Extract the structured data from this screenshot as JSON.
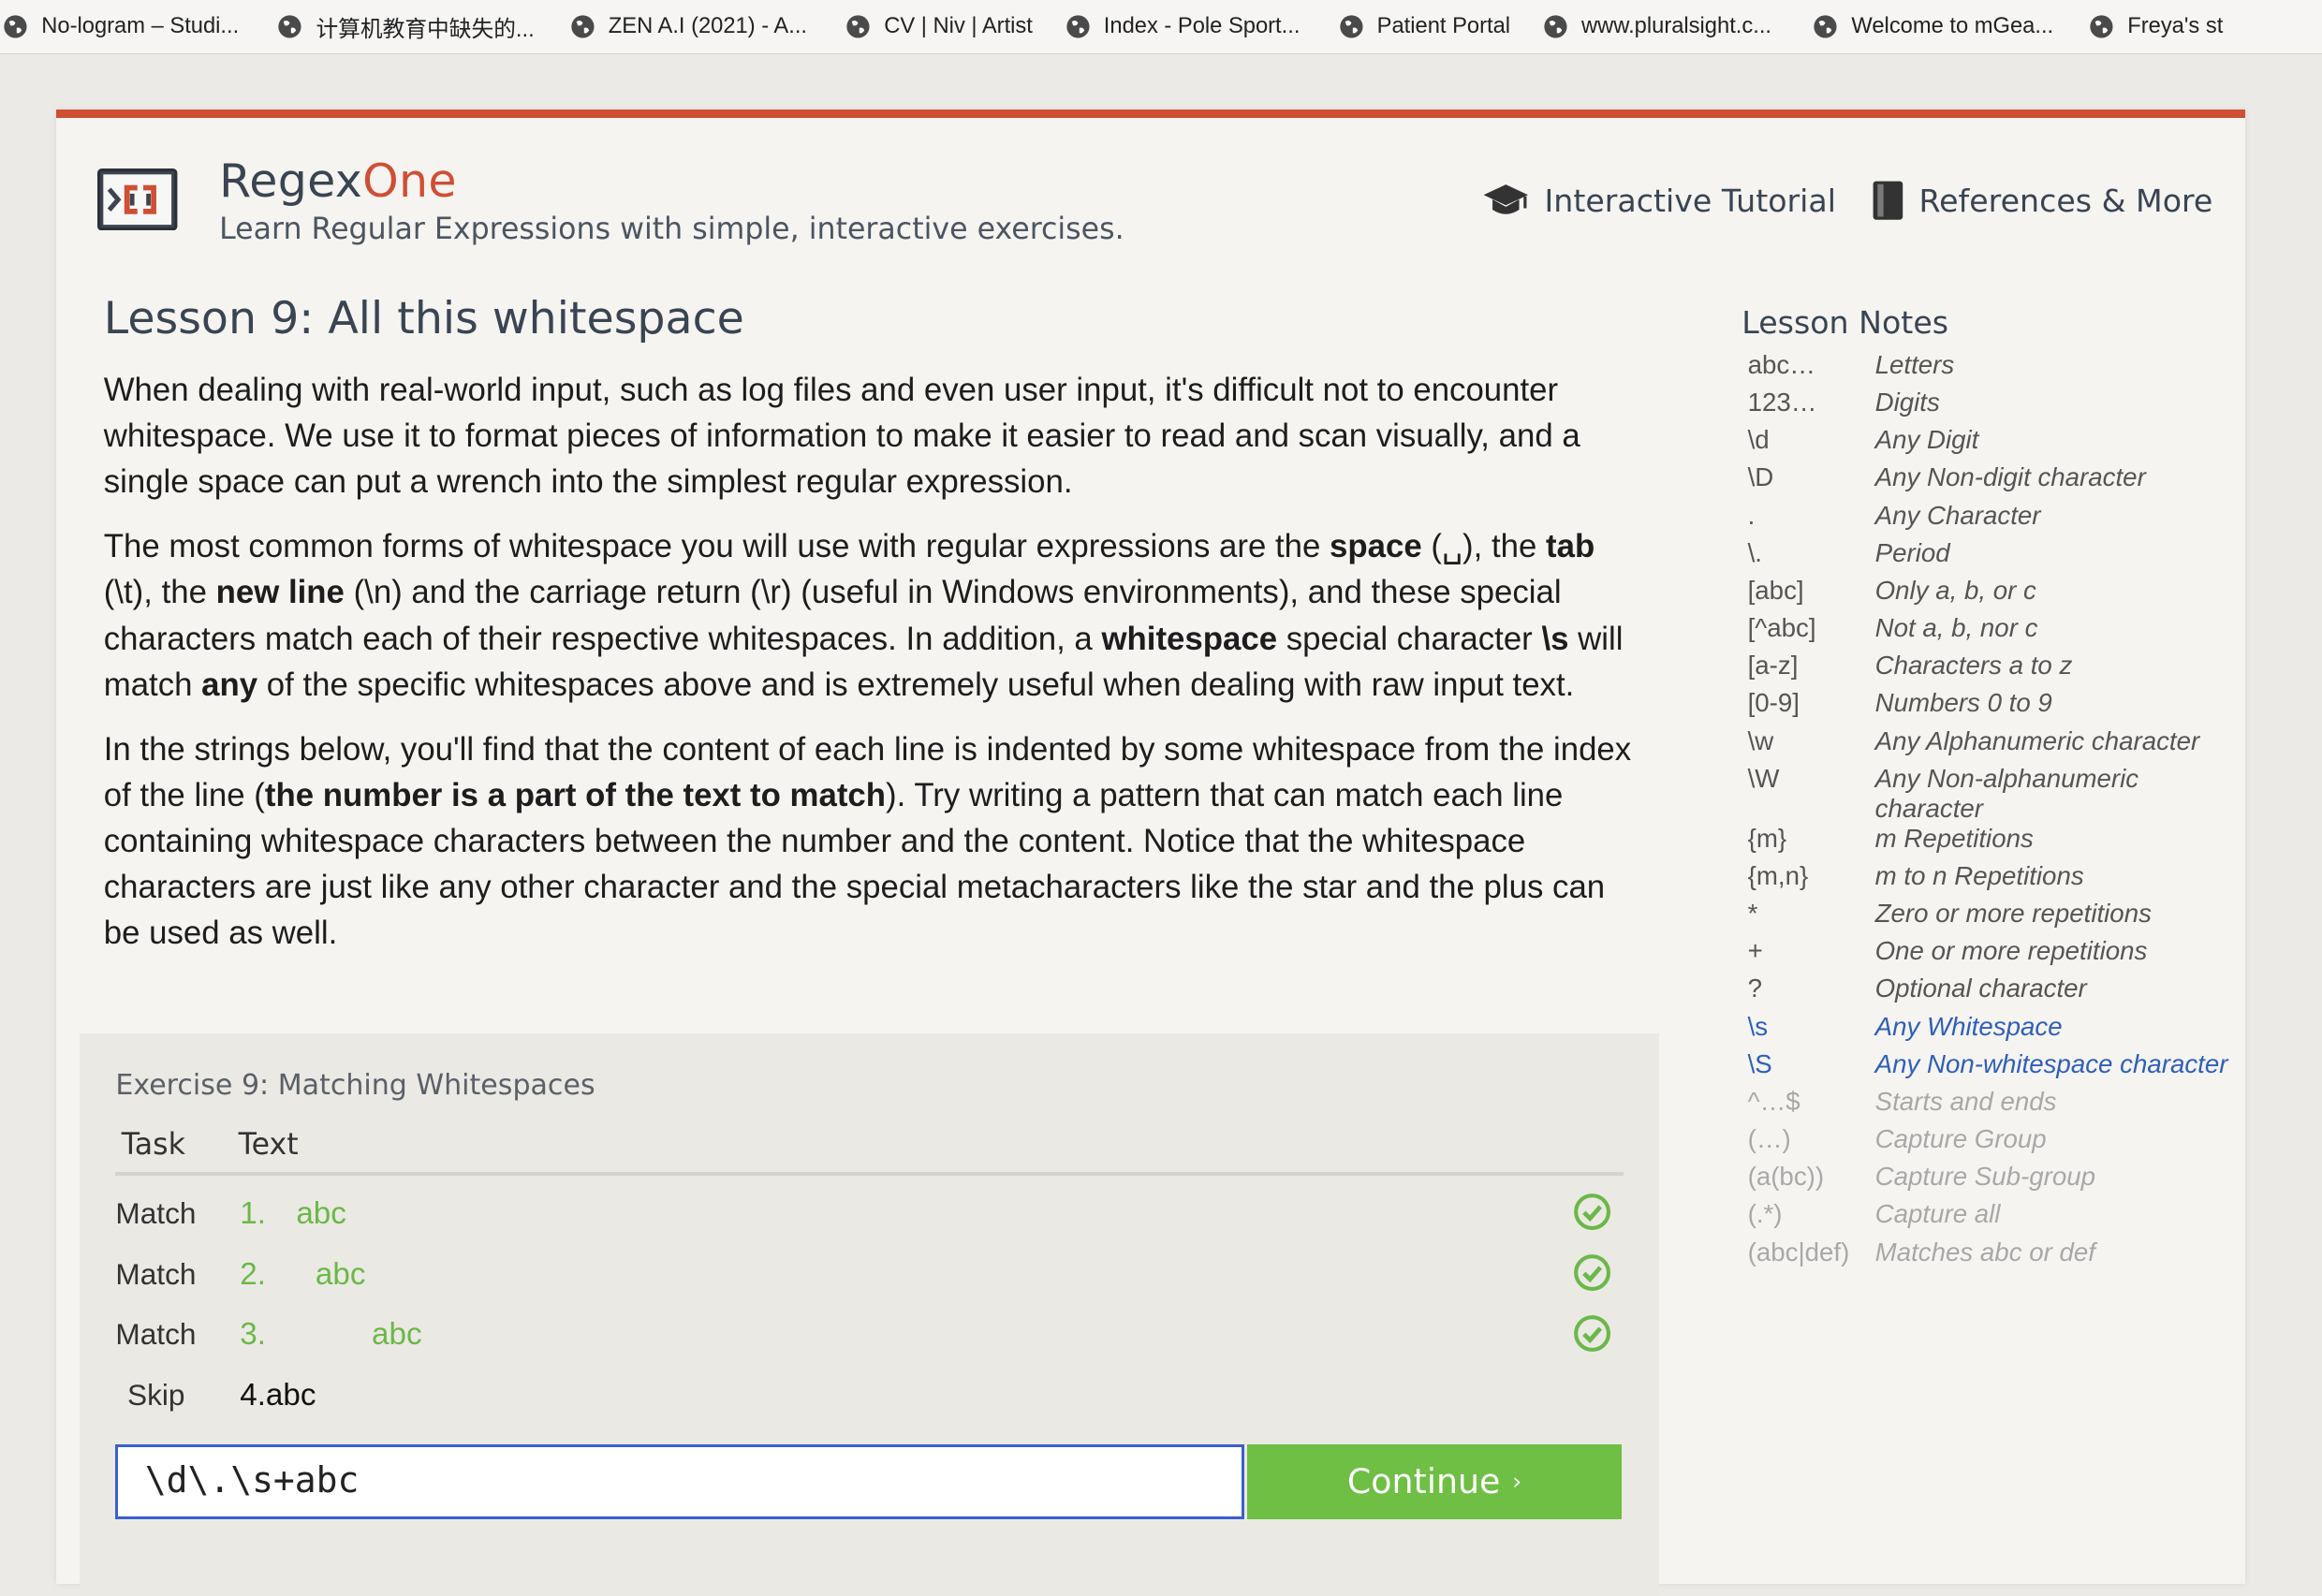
{
  "bookmarks": [
    {
      "label": "No-logram – Studi..."
    },
    {
      "label": "计算机教育中缺失的..."
    },
    {
      "label": "ZEN A.I (2021) - A..."
    },
    {
      "label": "CV | Niv | Artist"
    },
    {
      "label": "Index - Pole Sport..."
    },
    {
      "label": "Patient Portal"
    },
    {
      "label": "www.pluralsight.c..."
    },
    {
      "label": "Welcome to mGea..."
    },
    {
      "label": "Freya's st"
    }
  ],
  "header": {
    "brand_part1": "Regex",
    "brand_part2": "One",
    "tagline": "Learn Regular Expressions with simple, interactive exercises.",
    "nav_tutorial": "Interactive Tutorial",
    "nav_references": "References & More",
    "accent_color": "#cf4f34"
  },
  "lesson": {
    "title": "Lesson 9: All this whitespace",
    "p1": "When dealing with real-world input, such as log files and even user input, it's difficult not to encounter whitespace. We use it to format pieces of information to make it easier to read and scan visually, and a single space can put a wrench into the simplest regular expression.",
    "p2": {
      "a": "The most common forms of whitespace you will use with regular expressions are the ",
      "b1": "space",
      "c": " (␣), the ",
      "b2": "tab",
      "d": " (\\t), the ",
      "b3": "new line",
      "e": " (\\n) and the carriage return (\\r) (useful in Windows environments), and these special characters match each of their respective whitespaces. In addition, a ",
      "b4": "whitespace",
      "f": " special character ",
      "b5": "\\s",
      "g": " will match ",
      "b6": "any",
      "h": " of the specific whitespaces above and is extremely useful when dealing with raw input text."
    },
    "p3": {
      "a": "In the strings below, you'll find that the content of each line is indented by some whitespace from the index of the line (",
      "b1": "the number is a part of the text to match",
      "c": "). Try writing a pattern that can match each line containing whitespace characters between the number and the content. Notice that the whitespace characters are just like any other character and the special metacharacters like the star and the plus can be used as well."
    }
  },
  "notes": {
    "title": "Lesson Notes",
    "items": [
      {
        "k": "abc…",
        "v": "Letters",
        "state": "done"
      },
      {
        "k": "123…",
        "v": "Digits",
        "state": "done"
      },
      {
        "k": "\\d",
        "v": "Any Digit",
        "state": "done"
      },
      {
        "k": "\\D",
        "v": "Any Non-digit character",
        "state": "done"
      },
      {
        "k": ".",
        "v": "Any Character",
        "state": "done"
      },
      {
        "k": "\\.",
        "v": "Period",
        "state": "done"
      },
      {
        "k": "[abc]",
        "v": "Only a, b, or c",
        "state": "done"
      },
      {
        "k": "[^abc]",
        "v": "Not a, b, nor c",
        "state": "done"
      },
      {
        "k": "[a-z]",
        "v": "Characters a to z",
        "state": "done"
      },
      {
        "k": "[0-9]",
        "v": "Numbers 0 to 9",
        "state": "done"
      },
      {
        "k": "\\w",
        "v": "Any Alphanumeric character",
        "state": "done"
      },
      {
        "k": "\\W",
        "v": "Any Non-alphanumeric character",
        "state": "done"
      },
      {
        "k": "{m}",
        "v": "m Repetitions",
        "state": "done"
      },
      {
        "k": "{m,n}",
        "v": "m to n Repetitions",
        "state": "done"
      },
      {
        "k": "*",
        "v": "Zero or more repetitions",
        "state": "done"
      },
      {
        "k": "+",
        "v": "One or more repetitions",
        "state": "done"
      },
      {
        "k": "?",
        "v": "Optional character",
        "state": "done"
      },
      {
        "k": "\\s",
        "v": "Any Whitespace",
        "state": "active"
      },
      {
        "k": "\\S",
        "v": "Any Non-whitespace character",
        "state": "active"
      },
      {
        "k": "^…$",
        "v": "Starts and ends",
        "state": "future"
      },
      {
        "k": "(…)",
        "v": "Capture Group",
        "state": "future"
      },
      {
        "k": "(a(bc))",
        "v": "Capture Sub-group",
        "state": "future"
      },
      {
        "k": "(.*)",
        "v": "Capture all",
        "state": "future"
      },
      {
        "k": "(abc|def)",
        "v": "Matches abc or def",
        "state": "future"
      }
    ]
  },
  "exercise": {
    "title": "Exercise 9: Matching Whitespaces",
    "col_task": "Task",
    "col_text": "Text",
    "rows": [
      {
        "task": "Match",
        "num": "1.",
        "text": "abc",
        "status": "passed"
      },
      {
        "task": "Match",
        "num": "2.",
        "text": "abc",
        "status": "passed"
      },
      {
        "task": "Match",
        "num": "3.",
        "text": "abc",
        "status": "passed"
      },
      {
        "task": "Skip",
        "num": "",
        "text": "4.abc",
        "status": "none"
      }
    ],
    "input_value": "\\d\\.\\s+abc",
    "continue_label": "Continue",
    "continue_color": "#6ebf43"
  }
}
